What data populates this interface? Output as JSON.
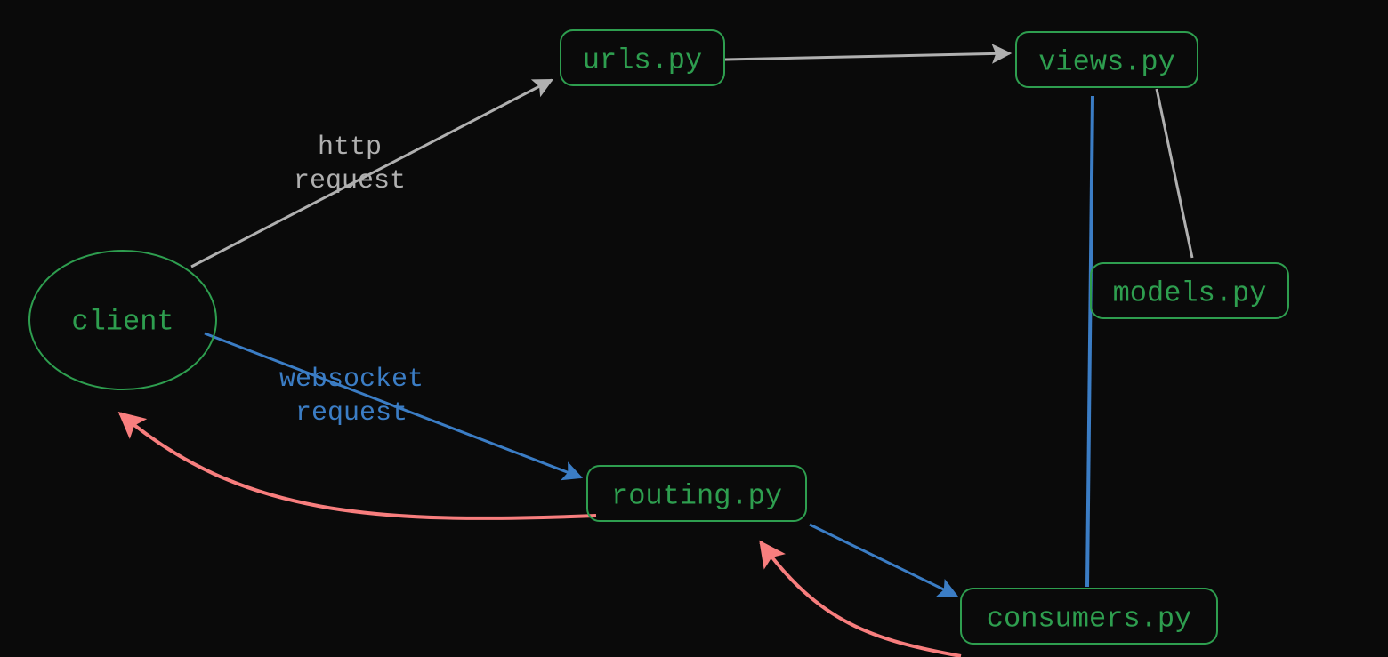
{
  "nodes": {
    "client": {
      "label": "client"
    },
    "urls": {
      "label": "urls.py"
    },
    "views": {
      "label": "views.py"
    },
    "models": {
      "label": "models.py"
    },
    "routing": {
      "label": "routing.py"
    },
    "consumers": {
      "label": "consumers.py"
    }
  },
  "edges": {
    "http": {
      "line1": "http",
      "line2": "request"
    },
    "websocket": {
      "line1": "websocket",
      "line2": "request"
    }
  },
  "colors": {
    "background": "#0a0a0a",
    "node_stroke": "#2e9e4f",
    "node_text": "#2e9e4f",
    "gray": "#b0b0b0",
    "blue": "#3b7dc5",
    "red": "#f87e7e"
  }
}
